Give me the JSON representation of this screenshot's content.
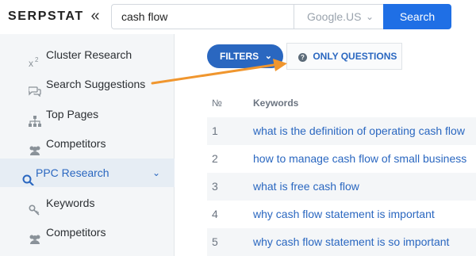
{
  "header": {
    "logo": "SERPSTAT",
    "collapse_icon": "double-chevron-left-icon",
    "search_value": "cash flow",
    "search_engine": "Google.US",
    "search_button": "Search"
  },
  "sidebar": {
    "items": [
      {
        "label": "Cluster Research",
        "icon": "superscript-x2-icon",
        "active": false
      },
      {
        "label": "Search Suggestions",
        "icon": "chat-bubbles-icon",
        "active": false
      },
      {
        "label": "Top Pages",
        "icon": "sitemap-icon",
        "active": false
      },
      {
        "label": "Competitors",
        "icon": "users-icon",
        "active": false
      },
      {
        "label": "PPC Research",
        "icon": "search-icon",
        "active": true
      },
      {
        "label": "Keywords",
        "icon": "key-icon",
        "active": false
      },
      {
        "label": "Competitors",
        "icon": "users-icon",
        "active": false
      }
    ]
  },
  "main": {
    "filters_label": "FILTERS",
    "only_questions_label": "ONLY QUESTIONS",
    "table": {
      "columns": [
        "№",
        "Keywords"
      ],
      "rows": [
        {
          "num": "1",
          "keyword": "what is the definition of operating cash flow"
        },
        {
          "num": "2",
          "keyword": "how to manage cash flow of small business"
        },
        {
          "num": "3",
          "keyword": "what is free cash flow"
        },
        {
          "num": "4",
          "keyword": "why cash flow statement is important"
        },
        {
          "num": "5",
          "keyword": "why cash flow statement is so important"
        }
      ]
    }
  },
  "colors": {
    "accent": "#2a67c0",
    "search_button": "#1f6fe5",
    "annotation_arrow": "#f0962e"
  }
}
